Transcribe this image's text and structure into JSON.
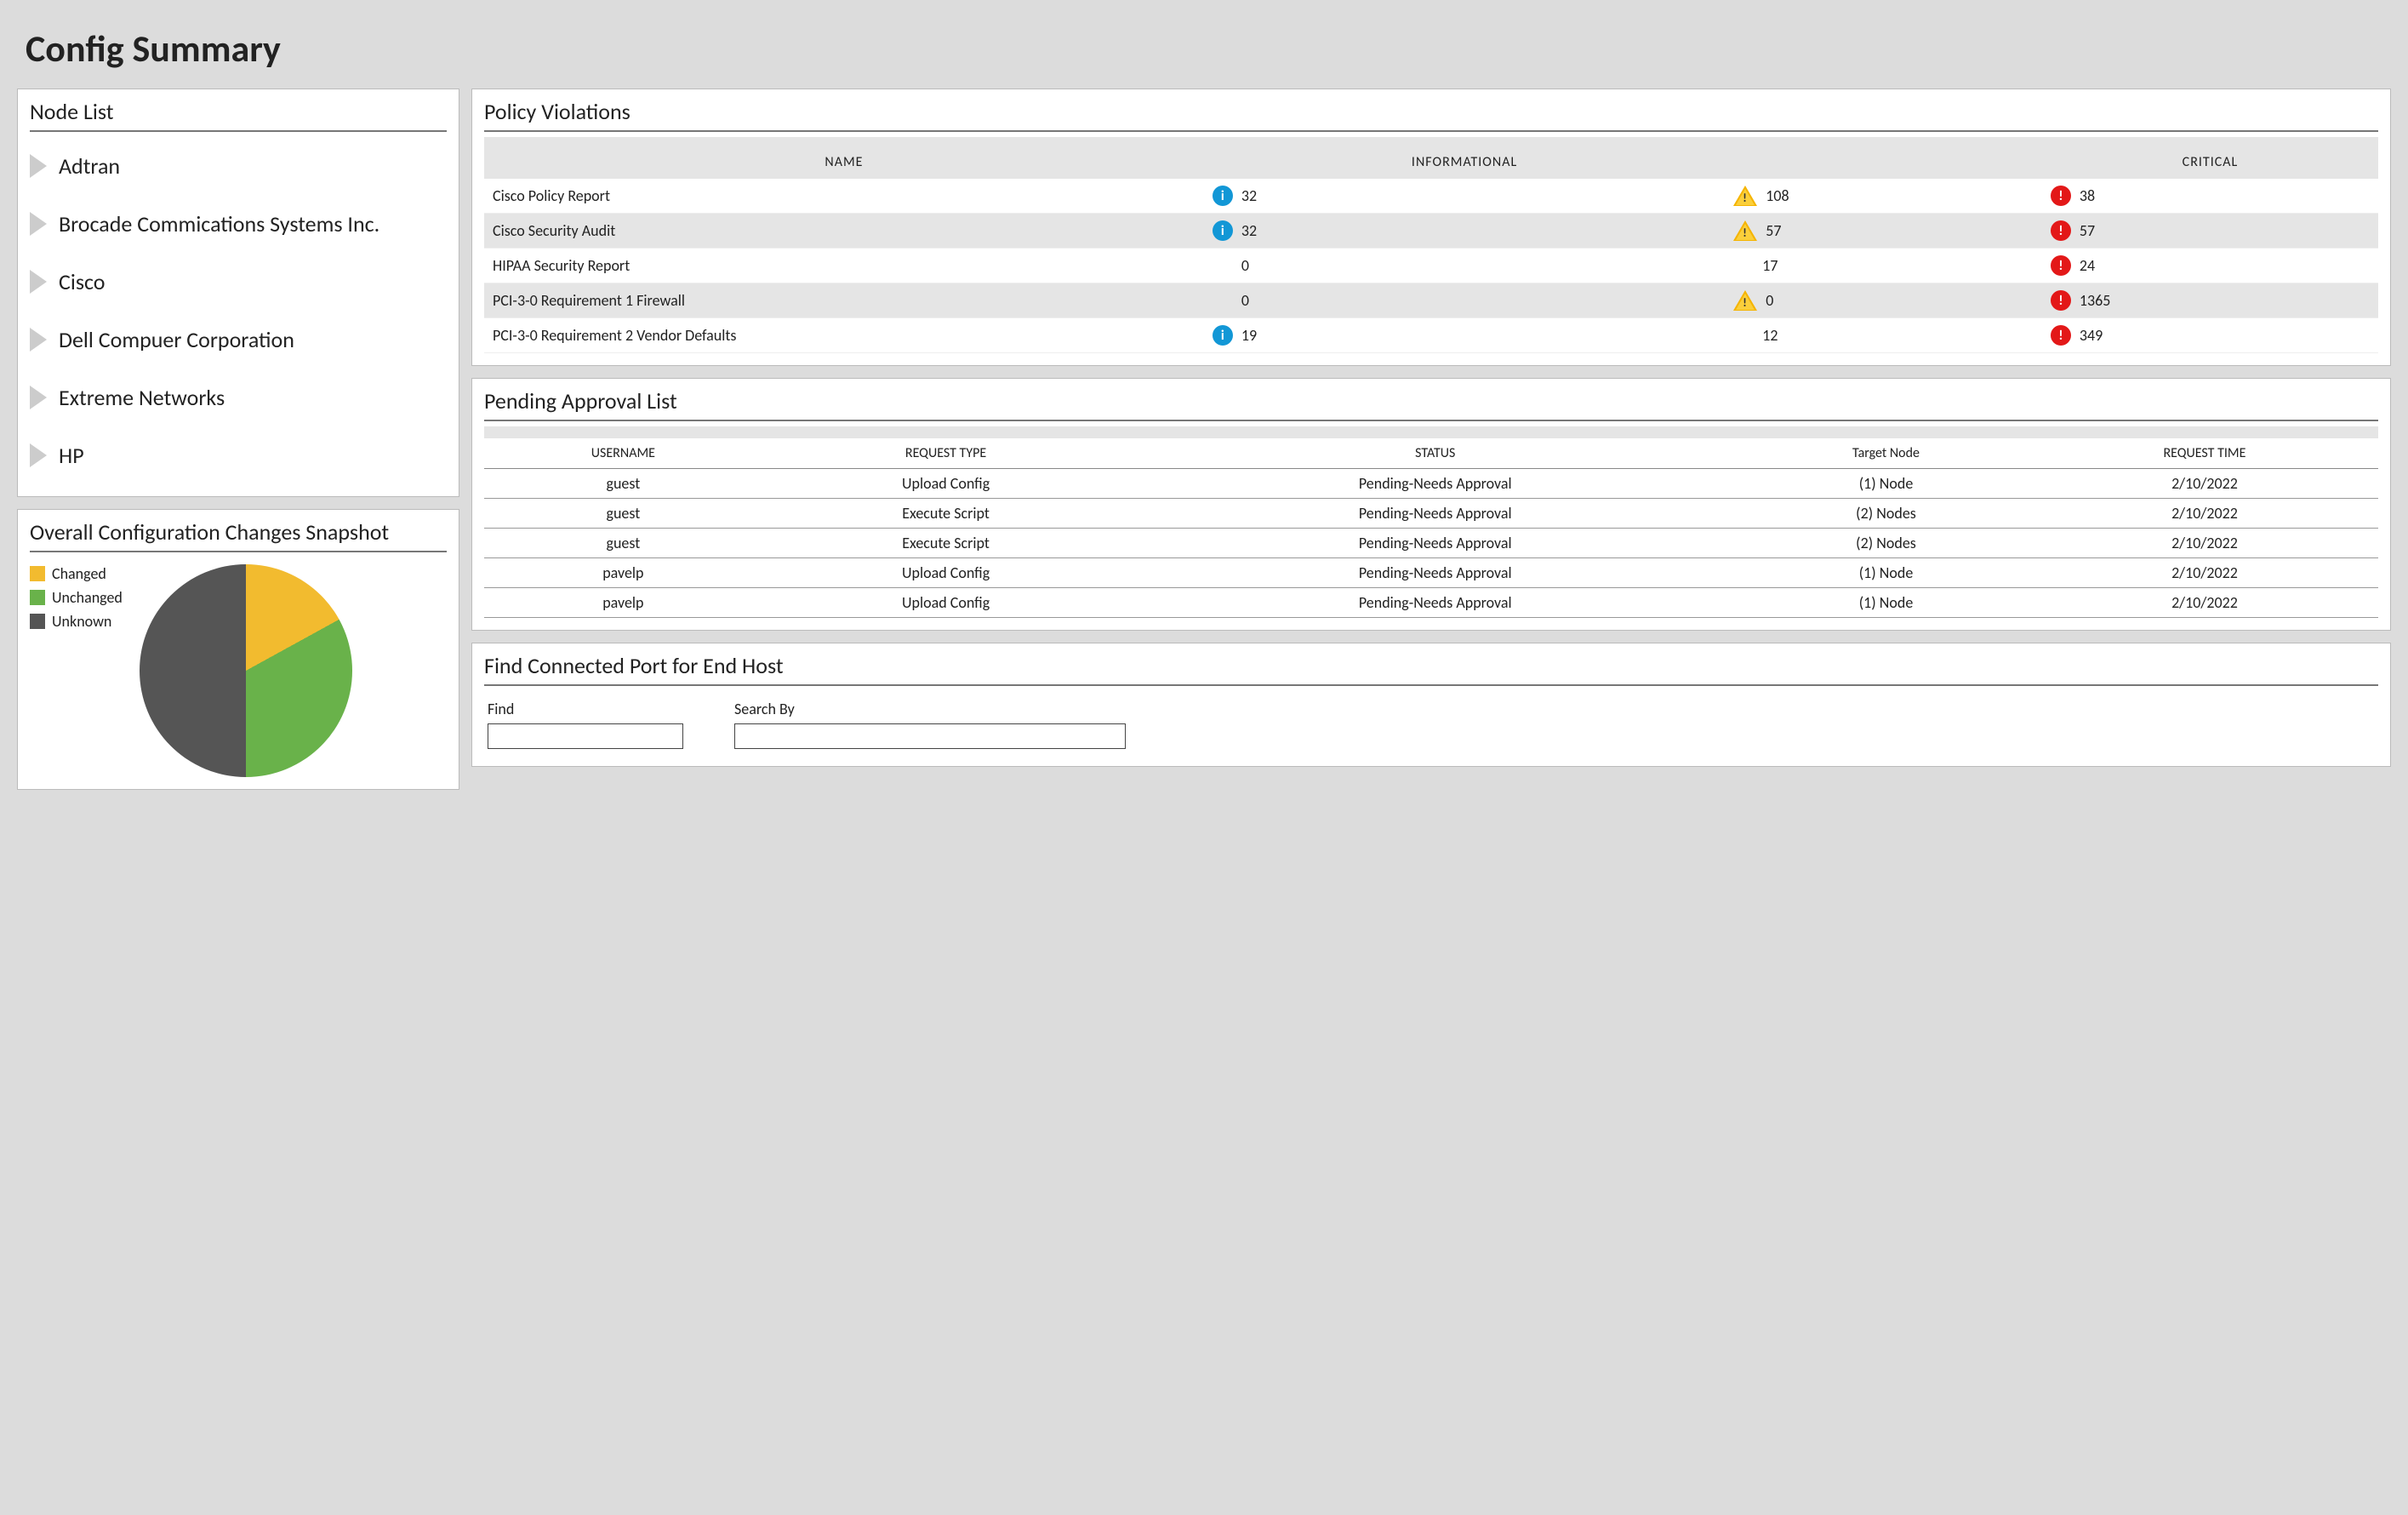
{
  "page_title": "Config Summary",
  "node_list": {
    "title": "Node List",
    "items": [
      "Adtran",
      "Brocade Commications Systems Inc.",
      "Cisco",
      "Dell Compuer Corporation",
      "Extreme Networks",
      "HP"
    ]
  },
  "snapshot": {
    "title": "Overall Configuration Changes Snapshot",
    "legend": [
      {
        "label": "Changed",
        "color": "#f2bb2f"
      },
      {
        "label": "Unchanged",
        "color": "#69b24a"
      },
      {
        "label": "Unknown",
        "color": "#555555"
      }
    ]
  },
  "chart_data": {
    "type": "pie",
    "title": "Overall Configuration Changes Snapshot",
    "series": [
      {
        "name": "Changed",
        "value": 17,
        "color": "#f2bb2f"
      },
      {
        "name": "Unchanged",
        "value": 33,
        "color": "#69b24a"
      },
      {
        "name": "Unknown",
        "value": 50,
        "color": "#555555"
      }
    ]
  },
  "policy_violations": {
    "title": "Policy Violations",
    "columns": [
      "NAME",
      "INFORMATIONAL",
      "",
      "CRITICAL"
    ],
    "rows": [
      {
        "name": "Cisco Policy Report",
        "info": 32,
        "info_icon": true,
        "warn": 108,
        "warn_icon": true,
        "crit": 38,
        "crit_icon": true
      },
      {
        "name": "Cisco Security Audit",
        "info": 32,
        "info_icon": true,
        "warn": 57,
        "warn_icon": true,
        "crit": 57,
        "crit_icon": true
      },
      {
        "name": "HIPAA Security Report",
        "info": 0,
        "info_icon": false,
        "warn": 17,
        "warn_icon": false,
        "crit": 24,
        "crit_icon": true
      },
      {
        "name": "PCI-3-0 Requirement 1 Firewall",
        "info": 0,
        "info_icon": false,
        "warn": 0,
        "warn_icon": true,
        "crit": 1365,
        "crit_icon": true
      },
      {
        "name": "PCI-3-0 Requirement 2 Vendor Defaults",
        "info": 19,
        "info_icon": true,
        "warn": 12,
        "warn_icon": false,
        "crit": 349,
        "crit_icon": true
      }
    ]
  },
  "pending_approval": {
    "title": "Pending Approval List",
    "columns": [
      "USERNAME",
      "REQUEST TYPE",
      "STATUS",
      "Target Node",
      "REQUEST TIME"
    ],
    "rows": [
      {
        "user": "guest",
        "type": "Upload Config",
        "status": "Pending-Needs Approval",
        "target": "(1) Node",
        "time": "2/10/2022"
      },
      {
        "user": "guest",
        "type": "Execute Script",
        "status": "Pending-Needs Approval",
        "target": "(2) Nodes",
        "time": "2/10/2022"
      },
      {
        "user": "guest",
        "type": "Execute Script",
        "status": "Pending-Needs Approval",
        "target": "(2) Nodes",
        "time": "2/10/2022"
      },
      {
        "user": "pavelp",
        "type": "Upload Config",
        "status": "Pending-Needs Approval",
        "target": "(1) Node",
        "time": "2/10/2022"
      },
      {
        "user": "pavelp",
        "type": "Upload Config",
        "status": "Pending-Needs Approval",
        "target": "(1) Node",
        "time": "2/10/2022"
      }
    ]
  },
  "find_panel": {
    "title": "Find Connected Port for End Host",
    "find_label": "Find",
    "search_by_label": "Search By",
    "find_value": "",
    "search_by_value": ""
  }
}
